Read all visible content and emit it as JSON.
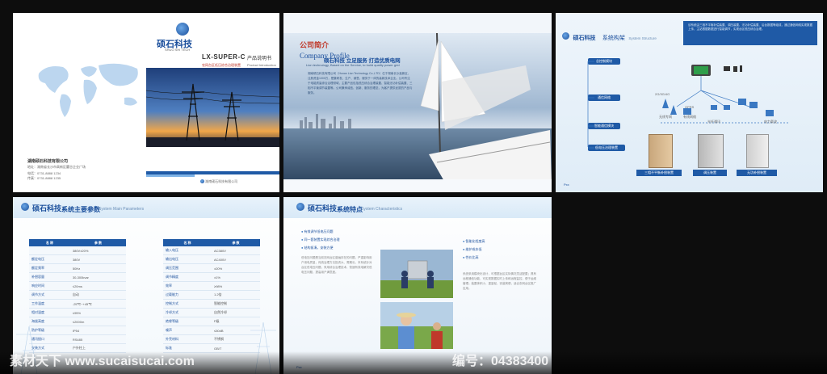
{
  "brand": {
    "name": "硕石科技",
    "en": "SHUO SHI TECH"
  },
  "cover": {
    "model": "LX-SUPER-C",
    "title": "产品说明书",
    "subtitle": "农网台区低压综合治理装置",
    "subtitle_en": "Product Introduction",
    "company": "湖南硕石科技有限公司",
    "address": "地址：湖南省长沙市高新区麓谷企业广场",
    "phone": "电话：0731-8888 1234",
    "fax": "传真：0731-8888 1235",
    "footer_brand": "湖南硕石科技有限公司"
  },
  "intro": {
    "title_cn": "公司简介",
    "title_en": "Company Profile",
    "slogan": "硕石科技 立足服务 打造优质电网",
    "slogan_en": "Lion technology, Based on the Service, to build quality power grid",
    "body": "湖南硕石科技有限公司（Hunan Lion Technology Co.,LTD）位于湖南长沙高新区，注册资金1000万，是集研发、生产、销售、服务于一体的高新技术企业。公司专注于电能质量综合治理领域，主要产品包括低压综合治理装置、智能无功补偿装置、三相不平衡调节装置等。公司秉承诚信、创新、服务的理念，为客户提供优质的产品与服务。"
  },
  "structure": {
    "title": "系统构架",
    "title_en": "System Structure",
    "note": "该系统由三相不平衡补偿装置、调压装置、无功补偿装置、后台数据等组成，通过通信网络实现数据上传，主站根据数据进行智能调节，实现台区低压综合治理。",
    "modules": [
      "总控制模块",
      "通信网络",
      "智能通信模块",
      "低电压治理装置"
    ],
    "devices": [
      "三相不平衡补偿装置",
      "调压装置",
      "无功补偿装置"
    ],
    "net_labels": [
      "2G/3G/4G",
      "无线专网",
      "有线网络",
      "GPRS",
      "光纤通讯",
      "电力载波"
    ]
  },
  "params": {
    "title": "系统主要参数",
    "title_en": "System Main Parameters",
    "col_name": "名 称",
    "col_value": "参 数",
    "left_rows": [
      [
        "",
        "380V±20%"
      ],
      [
        "额定电压",
        "380V"
      ],
      [
        "额定频率",
        "50Hz"
      ],
      [
        "补偿容量",
        "30-300kvar"
      ],
      [
        "响应时间",
        "≤20ms"
      ],
      [
        "调节方式",
        "自动"
      ],
      [
        "工作温度",
        "-25℃~+45℃"
      ],
      [
        "相对湿度",
        "≤95%"
      ],
      [
        "海拔高度",
        "≤2000m"
      ],
      [
        "防护等级",
        "IP54"
      ],
      [
        "通讯接口",
        "RS485"
      ],
      [
        "安装方式",
        "户外柱上"
      ]
    ],
    "right_rows": [
      [
        "输入电压",
        "AC380V"
      ],
      [
        "输出电压",
        "AC400V"
      ],
      [
        "调压范围",
        "±20%"
      ],
      [
        "调节精度",
        "±1%"
      ],
      [
        "效率",
        "≥98%"
      ],
      [
        "过载能力",
        "1.2倍"
      ],
      [
        "控制方式",
        "智能控制"
      ],
      [
        "冷却方式",
        "自然冷却"
      ],
      [
        "绝缘等级",
        "F级"
      ],
      [
        "噪声",
        "≤50dB"
      ],
      [
        "外壳材料",
        "不锈钢"
      ],
      [
        "标准",
        "GB/T"
      ]
    ],
    "page_no": "Pxx"
  },
  "features": {
    "title": "系统特点",
    "title_en": "System Characteristics",
    "items": [
      "有效调节低电压问题",
      "同一套装置实现综合治理",
      "结构紧凑，安装方便",
      "智能化程度高",
      "维护成本低",
      "性价比高"
    ],
    "left_text": "低电压问题是当前农网台区普遍存在的问题，严重影响用户用电质量，传统治理方法投资大、周期长。本系统针对台区低电压问题，采用综合治理技术，快速有效地解决低电压问题，提高用户满意度。",
    "right_text": "系统采用模块化设计，可根据台区实际情况灵活配置；具有远程通信功能，可实现数据实时上传和远程监控，便于运维管理；装置体积小、重量轻，安装简便，适合农网台区推广应用。",
    "page_no": "Pxx"
  },
  "watermark": {
    "left": "素材天下 www.sucaisucai.com",
    "right": "编号：04383400"
  }
}
